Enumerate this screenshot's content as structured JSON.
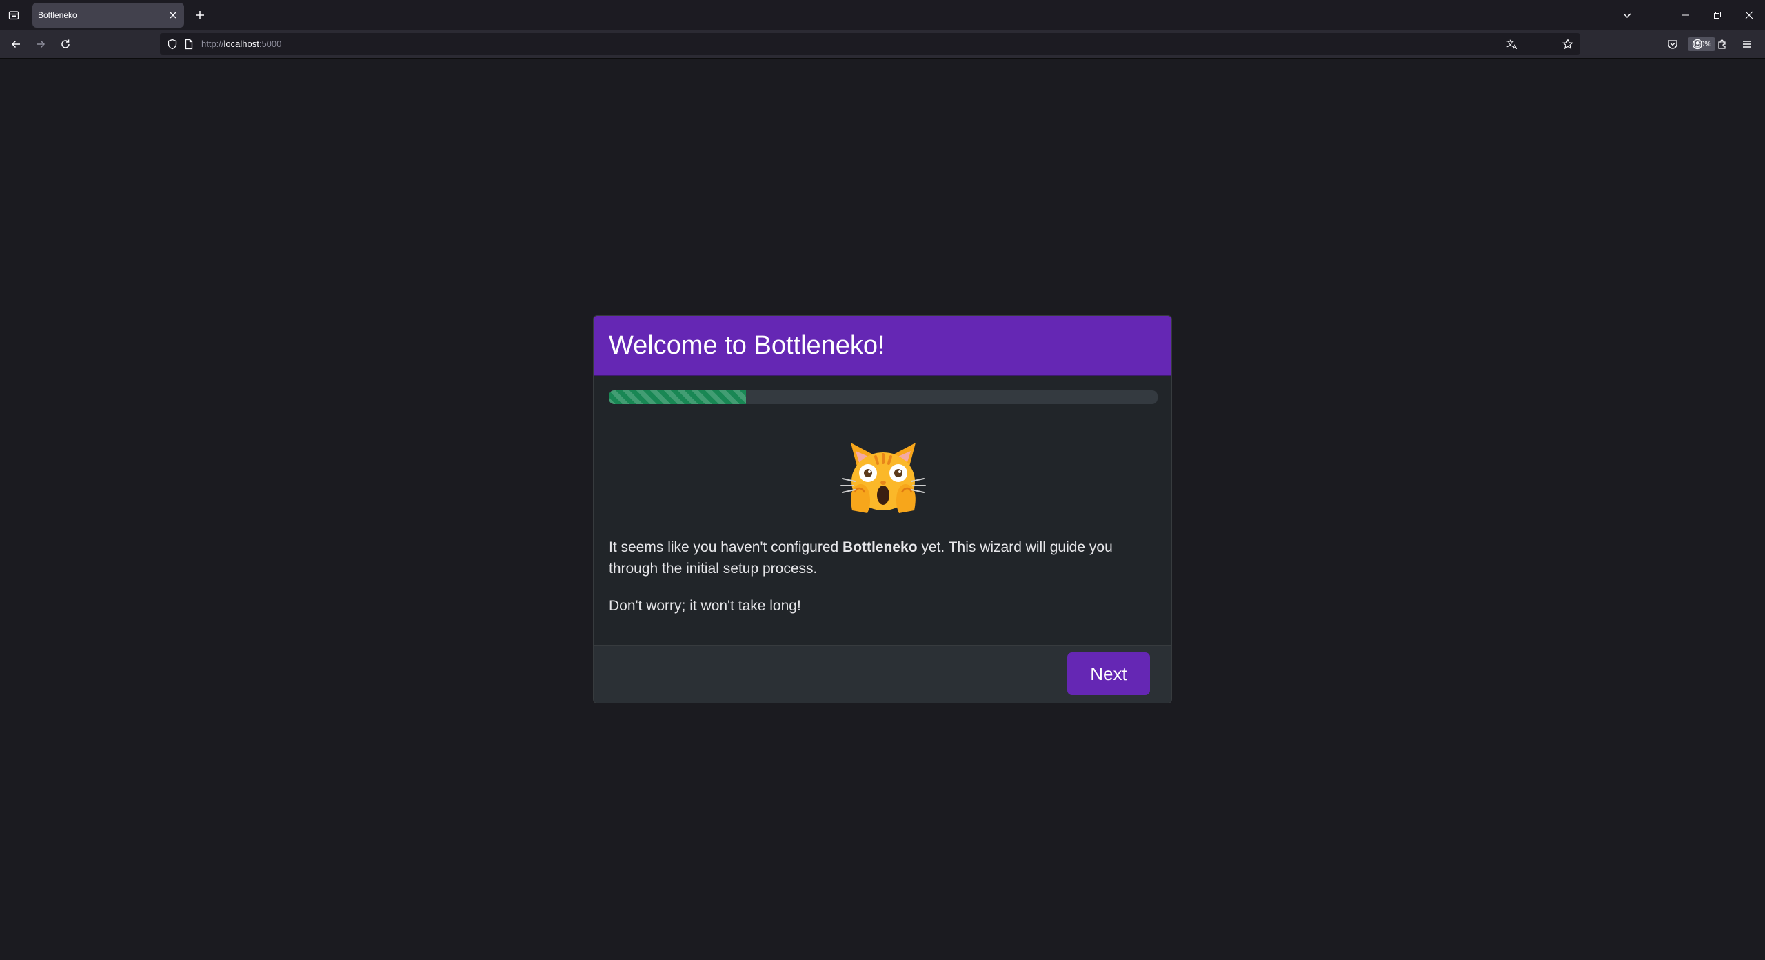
{
  "browser": {
    "tab_title": "Bottleneko",
    "url_scheme": "http://",
    "url_host": "localhost",
    "url_port": ":5000",
    "zoom_level": "150%"
  },
  "wizard": {
    "title": "Welcome to Bottleneko!",
    "progress_fraction": 0.25,
    "progress_color": "#198754",
    "accent_color": "#6527b4",
    "intro_before": "It seems like you haven't configured ",
    "app_name": "Bottleneko",
    "intro_after": " yet. This wizard will guide you through the initial setup process.",
    "reassurance": "Don't worry; it won't take long!",
    "next_label": "Next",
    "emoji_icon": "weary-cat-face"
  }
}
